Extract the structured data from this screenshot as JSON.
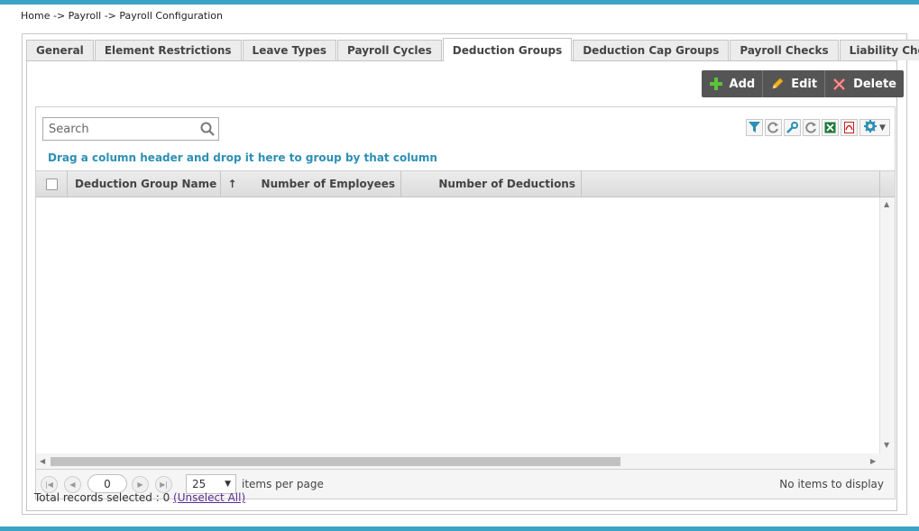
{
  "breadcrumb": [
    "Home",
    "->",
    "Payroll",
    "->",
    "Payroll Configuration"
  ],
  "tabs": [
    {
      "label": "General",
      "active": false
    },
    {
      "label": "Element Restrictions",
      "active": false
    },
    {
      "label": "Leave Types",
      "active": false
    },
    {
      "label": "Payroll Cycles",
      "active": false
    },
    {
      "label": "Deduction Groups",
      "active": true
    },
    {
      "label": "Deduction Cap Groups",
      "active": false
    },
    {
      "label": "Payroll Checks",
      "active": false
    },
    {
      "label": "Liability Checks",
      "active": false
    }
  ],
  "toolbar": {
    "add_label": "Add",
    "edit_label": "Edit",
    "delete_label": "Delete"
  },
  "search": {
    "placeholder": "Search",
    "value": ""
  },
  "grid": {
    "group_hint": "Drag a column header and drop it here to group by that column",
    "columns": [
      {
        "label": "Deduction Group Name",
        "sort": "↑"
      },
      {
        "label": "Number of Employees"
      },
      {
        "label": "Number of Deductions"
      }
    ],
    "rows": []
  },
  "pager": {
    "page": "0",
    "page_size": "25",
    "items_per_page_label": "items per page",
    "empty_message": "No items to display"
  },
  "footer": {
    "selected_label": "Total records selected : 0",
    "unselect_label": "(Unselect All)"
  },
  "colors": {
    "accent": "#3aa3c6",
    "link": "#2d8fb3",
    "toolbar_bg": "#555555"
  }
}
